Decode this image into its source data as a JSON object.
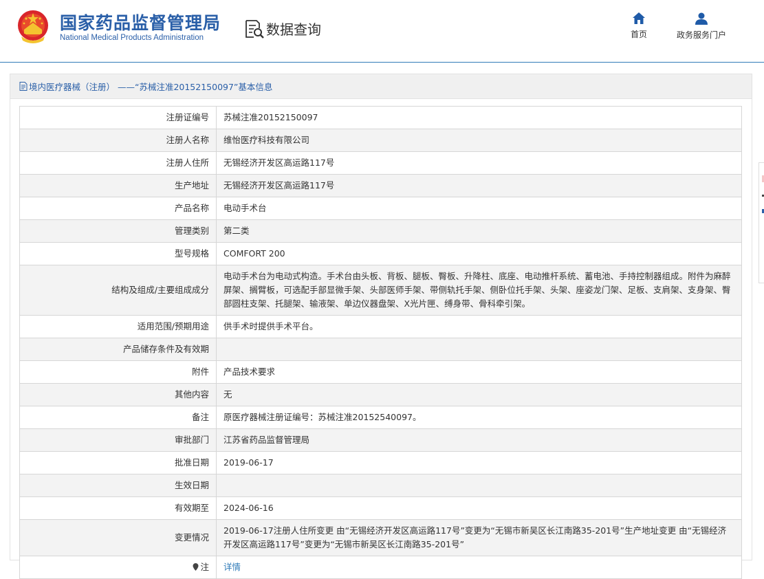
{
  "header": {
    "brand_cn": "国家药品监督管理局",
    "brand_en": "National Medical Products Administration",
    "system_title": "数据查询",
    "nav": [
      {
        "label": "首页",
        "icon": "home-icon"
      },
      {
        "label": "政务服务门户",
        "icon": "user-icon"
      }
    ]
  },
  "colors": {
    "brand_blue": "#2a5fa8",
    "link_blue": "#2f7bb8",
    "rule": "#2f7bb8"
  },
  "panel": {
    "title": "境内医疗器械（注册） ——“苏械注准20152150097”基本信息",
    "rows": [
      {
        "label": "注册证编号",
        "value": "苏械注准20152150097"
      },
      {
        "label": "注册人名称",
        "value": "维怡医疗科技有限公司"
      },
      {
        "label": "注册人住所",
        "value": "无锡经济开发区高运路117号"
      },
      {
        "label": "生产地址",
        "value": "无锡经济开发区高运路117号"
      },
      {
        "label": "产品名称",
        "value": "电动手术台"
      },
      {
        "label": "管理类别",
        "value": "第二类"
      },
      {
        "label": "型号规格",
        "value": "COMFORT 200"
      },
      {
        "label": "结构及组成/主要组成成分",
        "value": "电动手术台为电动式构造。手术台由头板、背板、腿板、臀板、升降柱、底座、电动推杆系统、蓄电池、手持控制器组成。附件为麻醉屏架、搁臂板，可选配手部显微手架、头部医师手架、带侧轨托手架、侧卧位托手架、头架、座姿龙门架、足板、支肩架、支身架、臀部圆柱支架、托腿架、输液架、单边仪器盘架、X光片匣、缚身带、骨科牵引架。"
      },
      {
        "label": "适用范围/预期用途",
        "value": "供手术时提供手术平台。"
      },
      {
        "label": "产品储存条件及有效期",
        "value": ""
      },
      {
        "label": "附件",
        "value": "产品技术要求"
      },
      {
        "label": "其他内容",
        "value": "无"
      },
      {
        "label": "备注",
        "value": "原医疗器械注册证编号：苏械注准20152540097。"
      },
      {
        "label": "审批部门",
        "value": "江苏省药品监督管理局"
      },
      {
        "label": "批准日期",
        "value": "2019-06-17"
      },
      {
        "label": "生效日期",
        "value": ""
      },
      {
        "label": "有效期至",
        "value": "2024-06-16"
      },
      {
        "label": "变更情况",
        "value": "2019-06-17注册人住所变更 由“无锡经济开发区高运路117号”变更为“无锡市新吴区长江南路35-201号”生产地址变更 由“无锡经济开发区高运路117号”变更为“无锡市新吴区长江南路35-201号”"
      }
    ],
    "note_row": {
      "label": "注",
      "link": "详情"
    }
  }
}
